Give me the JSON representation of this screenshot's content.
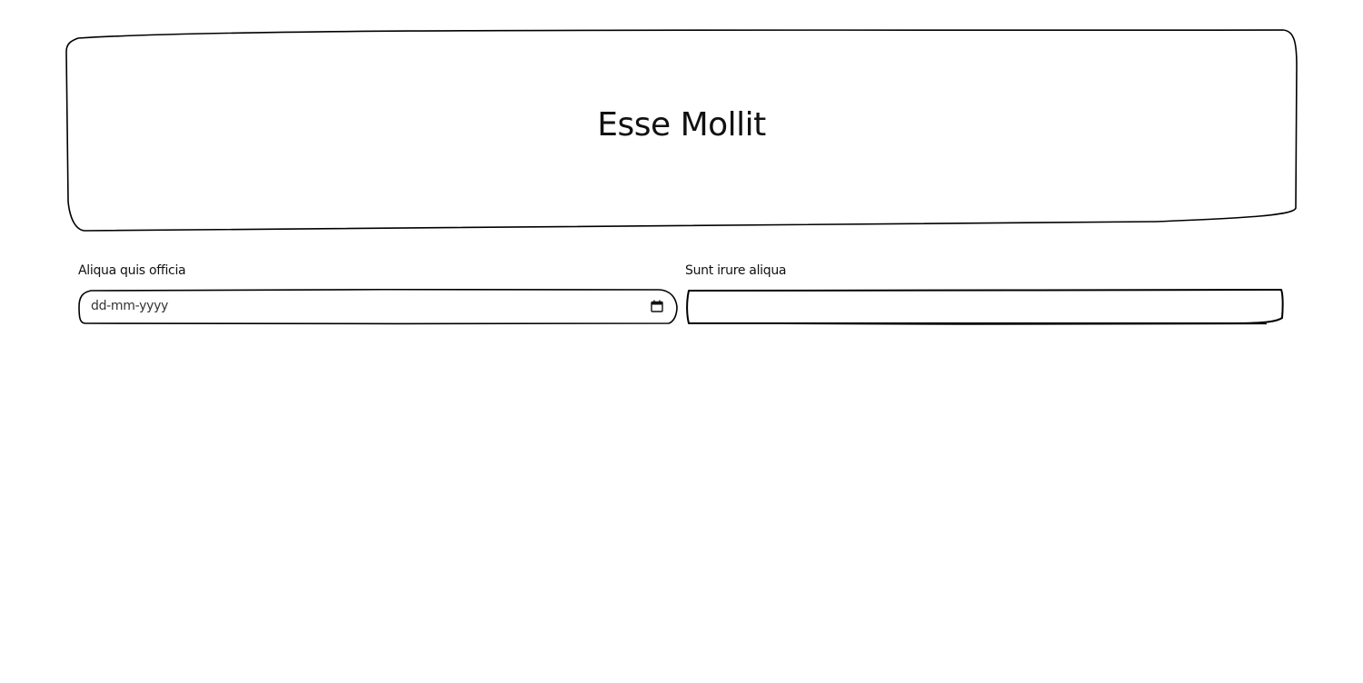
{
  "header": {
    "title": "Esse Mollit"
  },
  "form": {
    "date_field": {
      "label": "Aliqua quis officia",
      "placeholder": "dd-mm-yyyy",
      "icon": "calendar-icon"
    },
    "text_field": {
      "label": "Sunt irure aliqua",
      "value": ""
    }
  },
  "colors": {
    "stroke": "#000000",
    "background": "#ffffff",
    "text": "#111111"
  }
}
